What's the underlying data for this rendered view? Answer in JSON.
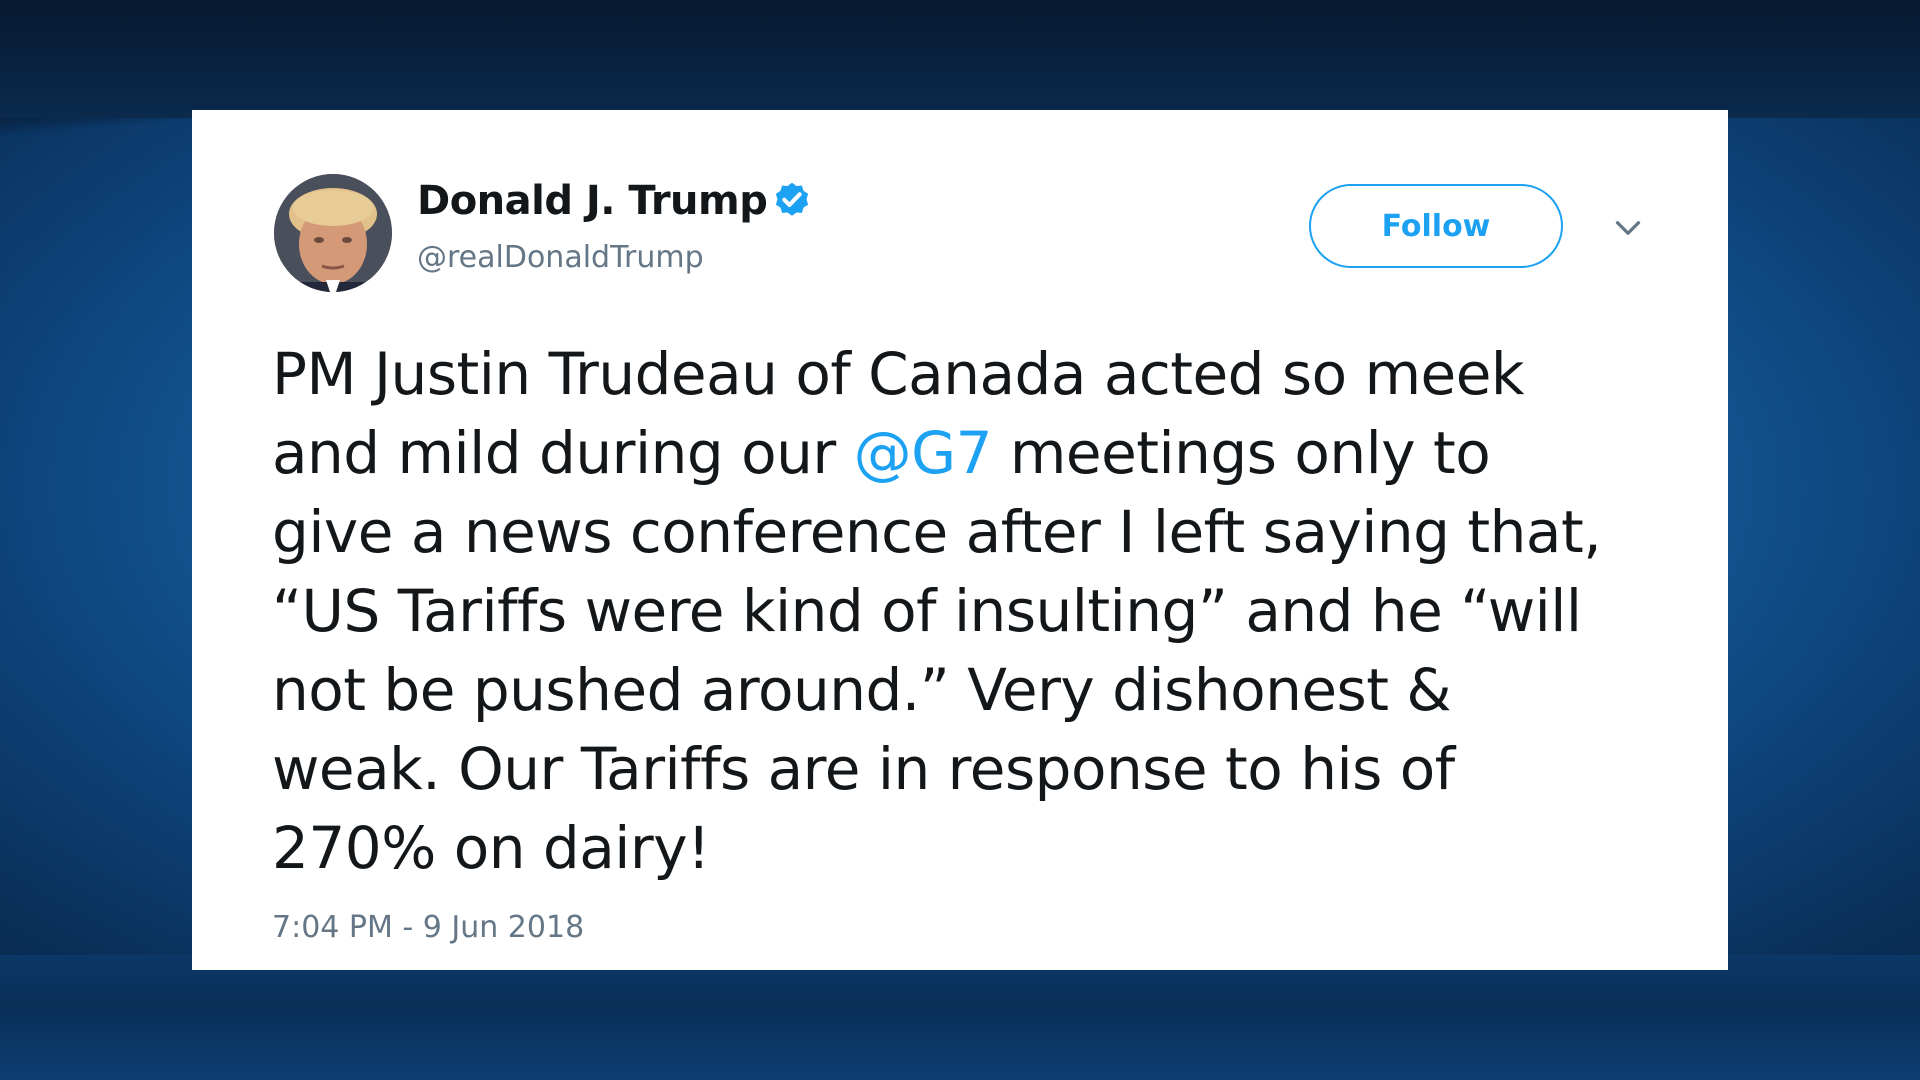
{
  "colors": {
    "accent": "#1da1f2",
    "text": "#14171a",
    "muted": "#657786",
    "background": "#155a9c"
  },
  "tweet": {
    "author": {
      "display_name": "Donald J. Trump",
      "handle": "@realDonaldTrump",
      "verified_icon": "verified-badge-icon",
      "avatar_icon": "avatar"
    },
    "follow_label": "Follow",
    "menu_icon": "chevron-down-icon",
    "text_lines": [
      {
        "before": "PM Justin Trudeau of Canada acted so meek",
        "mention": "",
        "after": ""
      },
      {
        "before": "and mild during our ",
        "mention": "@G7",
        "after": " meetings only to"
      },
      {
        "before": "give a news conference after I left saying that,",
        "mention": "",
        "after": ""
      },
      {
        "before": "“US Tariffs were kind of insulting” and he “will",
        "mention": "",
        "after": ""
      },
      {
        "before": "not be pushed around.” Very dishonest &",
        "mention": "",
        "after": ""
      },
      {
        "before": "weak. Our Tariffs are in response to his of",
        "mention": "",
        "after": ""
      },
      {
        "before": "270% on dairy!",
        "mention": "",
        "after": ""
      }
    ],
    "timestamp": "7:04 PM - 9 Jun 2018"
  }
}
